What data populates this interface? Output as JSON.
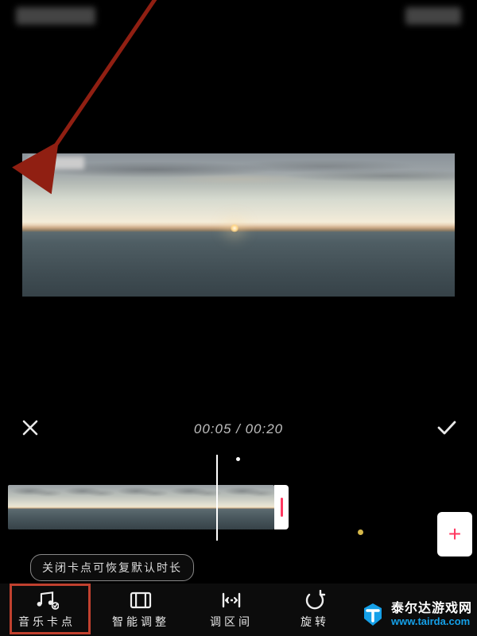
{
  "header": {
    "left_blur": true,
    "right_blur": true
  },
  "time": {
    "current": "00:05",
    "separator": " / ",
    "total": "00:20"
  },
  "tooltip": {
    "text": "关闭卡点可恢复默认时长"
  },
  "toolbar": {
    "items": [
      {
        "id": "music-beat",
        "label": "音乐卡点",
        "highlighted": true
      },
      {
        "id": "smart-adjust",
        "label": "智能调整",
        "highlighted": false
      },
      {
        "id": "adjust-range",
        "label": "调区间",
        "highlighted": false
      },
      {
        "id": "rotate",
        "label": "旋转",
        "highlighted": false
      }
    ]
  },
  "addButton": {
    "glyph": "+"
  },
  "watermark": {
    "name": "泰尔达游戏网",
    "url": "www.tairda.com"
  },
  "icons": {
    "close": "close-icon",
    "confirm": "check-icon",
    "music": "music-beat-icon",
    "smart": "smart-adjust-icon",
    "range": "range-icon",
    "rotate": "rotate-icon"
  },
  "colors": {
    "highlight_box": "#c1412f",
    "arrow": "#901f12",
    "accent_red": "#ff3860",
    "link_blue": "#15a0e8"
  }
}
